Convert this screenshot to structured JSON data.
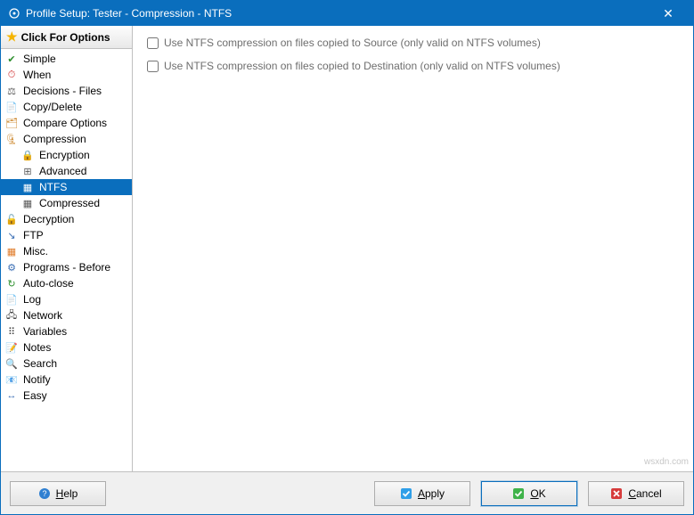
{
  "window": {
    "title": "Profile Setup: Tester - Compression - NTFS"
  },
  "sidebar": {
    "header": "Click For Options",
    "items": [
      {
        "label": "Simple",
        "icon": "✔",
        "iconColor": "#2d8f2d",
        "child": false,
        "selected": false
      },
      {
        "label": "When",
        "icon": "⏱",
        "iconColor": "#d03030",
        "child": false,
        "selected": false
      },
      {
        "label": "Decisions - Files",
        "icon": "⚖",
        "iconColor": "#5a5a5a",
        "child": false,
        "selected": false
      },
      {
        "label": "Copy/Delete",
        "icon": "📄",
        "iconColor": "#7a5b2e",
        "child": false,
        "selected": false
      },
      {
        "label": "Compare Options",
        "icon": "🗂",
        "iconColor": "#c97f1e",
        "child": false,
        "selected": false
      },
      {
        "label": "Compression",
        "icon": "🗜",
        "iconColor": "#c97f1e",
        "child": false,
        "selected": false
      },
      {
        "label": "Encryption",
        "icon": "🔒",
        "iconColor": "#c97f1e",
        "child": true,
        "selected": false
      },
      {
        "label": "Advanced",
        "icon": "⊞",
        "iconColor": "#5a5a5a",
        "child": true,
        "selected": false
      },
      {
        "label": "NTFS",
        "icon": "▦",
        "iconColor": "#ffffff",
        "child": true,
        "selected": true
      },
      {
        "label": "Compressed",
        "icon": "▦",
        "iconColor": "#5a5a5a",
        "child": true,
        "selected": false
      },
      {
        "label": "Decryption",
        "icon": "🔓",
        "iconColor": "#c97f1e",
        "child": false,
        "selected": false
      },
      {
        "label": "FTP",
        "icon": "↘",
        "iconColor": "#3b6fb5",
        "child": false,
        "selected": false
      },
      {
        "label": "Misc.",
        "icon": "▦",
        "iconColor": "#e07b29",
        "child": false,
        "selected": false
      },
      {
        "label": "Programs - Before",
        "icon": "⚙",
        "iconColor": "#3b6fb5",
        "child": false,
        "selected": false
      },
      {
        "label": "Auto-close",
        "icon": "↻",
        "iconColor": "#2d8f2d",
        "child": false,
        "selected": false
      },
      {
        "label": "Log",
        "icon": "📄",
        "iconColor": "#888888",
        "child": false,
        "selected": false
      },
      {
        "label": "Network",
        "icon": "🖧",
        "iconColor": "#444444",
        "child": false,
        "selected": false
      },
      {
        "label": "Variables",
        "icon": "⠿",
        "iconColor": "#444444",
        "child": false,
        "selected": false
      },
      {
        "label": "Notes",
        "icon": "📝",
        "iconColor": "#555555",
        "child": false,
        "selected": false
      },
      {
        "label": "Search",
        "icon": "🔍",
        "iconColor": "#2d8f2d",
        "child": false,
        "selected": false
      },
      {
        "label": "Notify",
        "icon": "📧",
        "iconColor": "#666666",
        "child": false,
        "selected": false
      },
      {
        "label": "Easy",
        "icon": "↔",
        "iconColor": "#3b6fb5",
        "child": false,
        "selected": false
      }
    ]
  },
  "main": {
    "checkbox_source": "Use NTFS compression on files copied to Source (only valid on NTFS volumes)",
    "checkbox_destination": "Use NTFS compression on files copied to Destination (only valid on NTFS volumes)"
  },
  "footer": {
    "help": "Help",
    "apply": "Apply",
    "ok": "OK",
    "cancel": "Cancel"
  },
  "watermark": "wsxdn.com"
}
